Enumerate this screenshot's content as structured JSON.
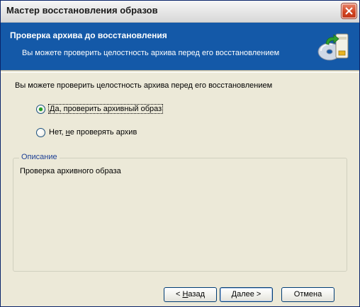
{
  "window": {
    "title": "Мастер восстановления образов",
    "close_icon": "close-icon"
  },
  "header": {
    "title": "Проверка архива до восстановления",
    "subtitle": "Вы можете проверить целостность архива перед его восстановлением",
    "icon": "disk-restore-icon"
  },
  "main": {
    "prompt": "Вы можете проверить целостность архива перед его восстановлением",
    "options": [
      {
        "prefix": "",
        "mnemonic": "Д",
        "rest": "а, проверить архивный образ",
        "selected": true
      },
      {
        "prefix": "Нет, ",
        "mnemonic": "н",
        "rest": "е проверять архив",
        "selected": false
      }
    ],
    "description": {
      "legend": "Описание",
      "text": "Проверка архивного образа"
    }
  },
  "buttons": {
    "back": {
      "prefix": "< ",
      "mnemonic": "Н",
      "rest": "азад"
    },
    "next": {
      "prefix": "",
      "mnemonic": "Д",
      "rest": "алее >"
    },
    "cancel": {
      "prefix": "",
      "mnemonic": "",
      "rest": "Отмена"
    }
  },
  "colors": {
    "header_bg": "#1459a8",
    "window_bg": "#ece9d8",
    "radio_selected": "#21a121",
    "close_button": "#d0431f"
  }
}
